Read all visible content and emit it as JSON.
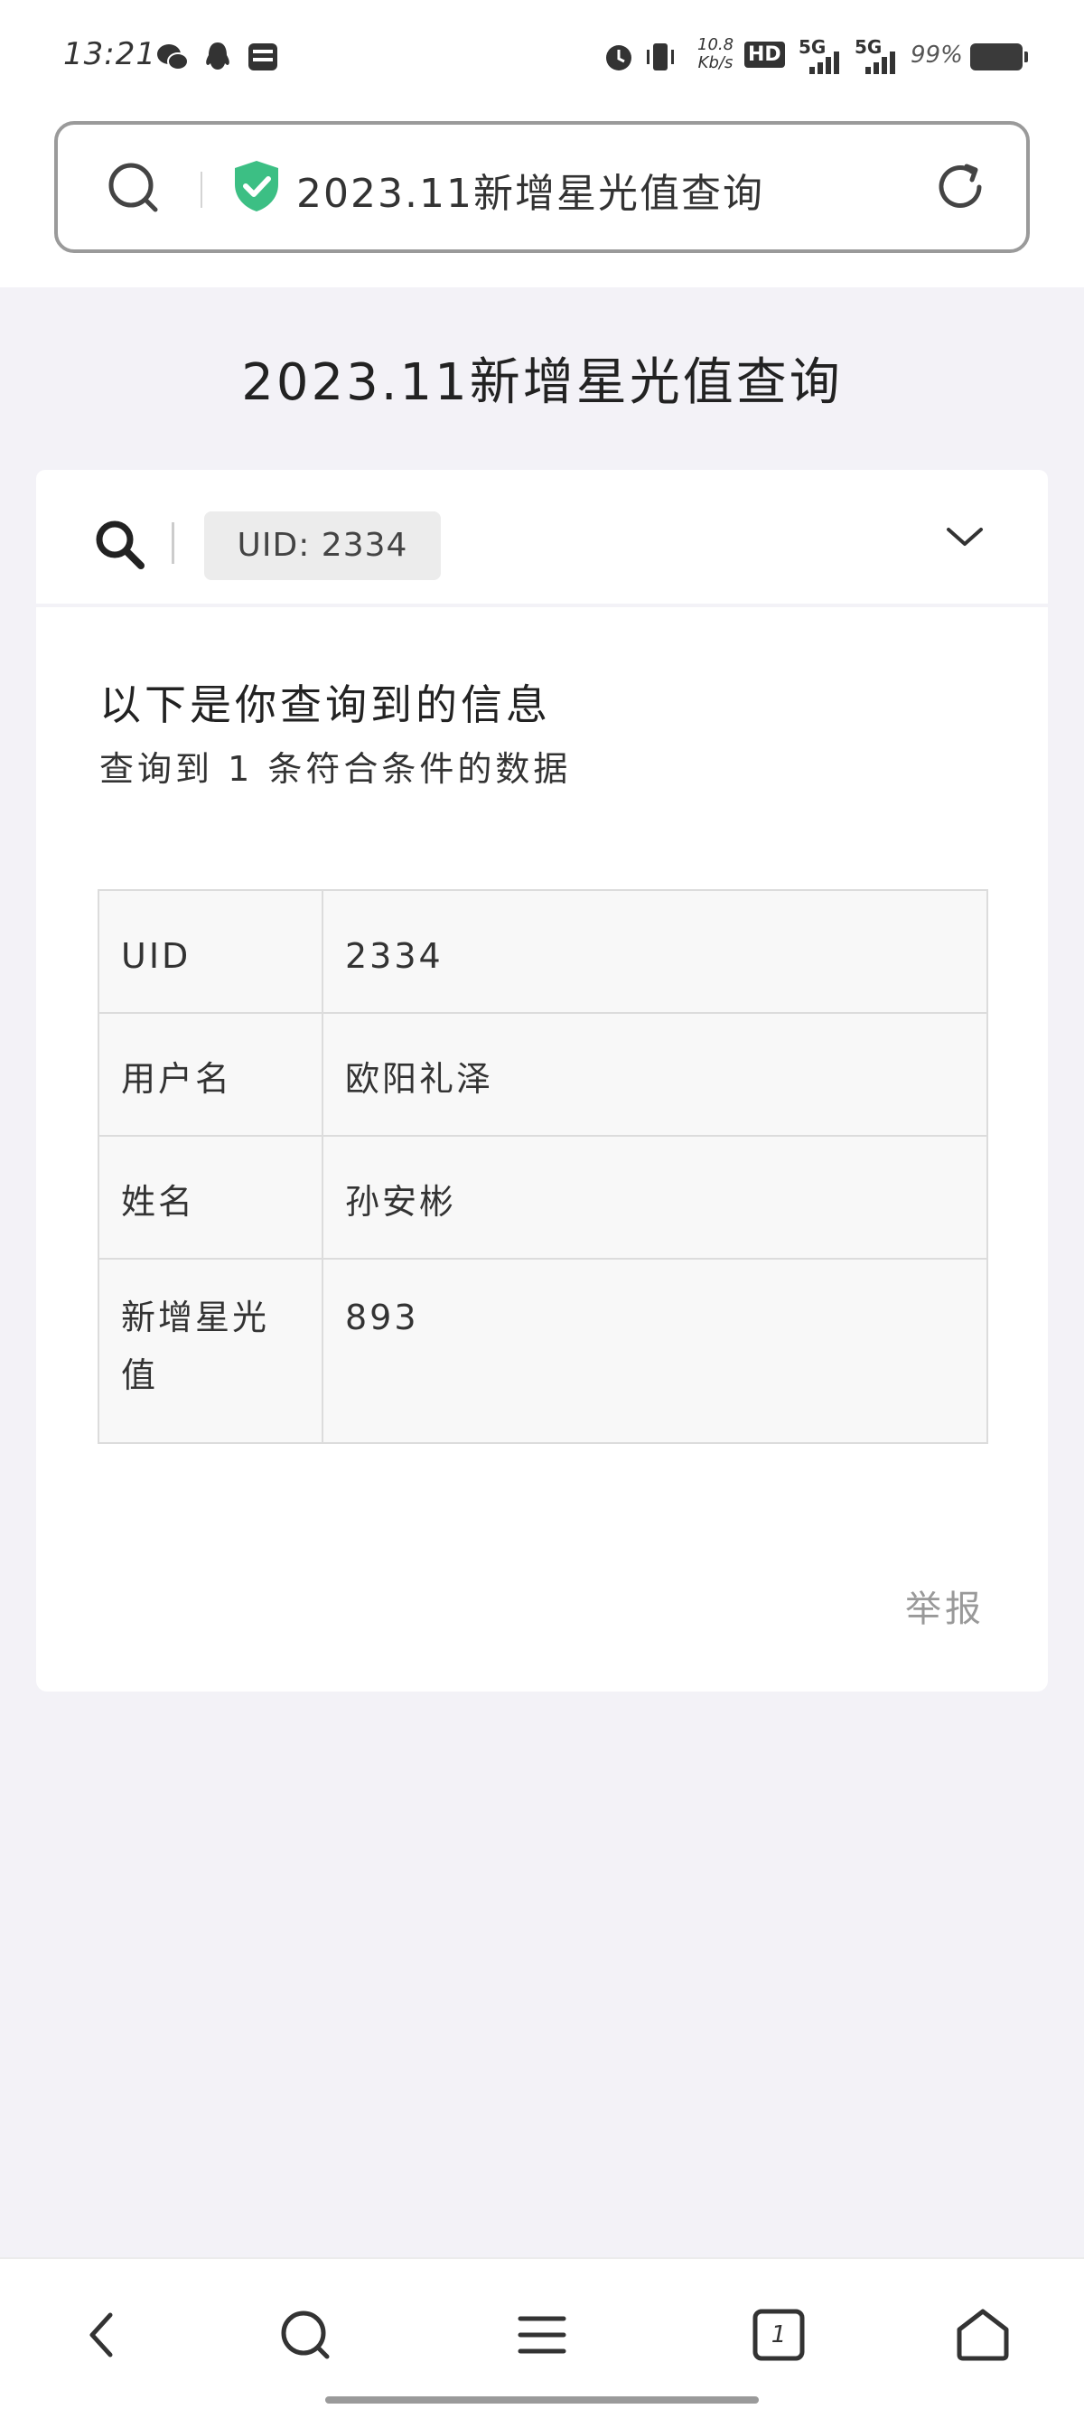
{
  "status_bar": {
    "time": "13:21",
    "net_speed": "10.8 Kb/s",
    "hd_label": "HD",
    "sim1": "5G",
    "sim2": "5G",
    "battery": "99%",
    "icons": [
      "wechat-icon",
      "qq-icon",
      "card-icon",
      "alarm-icon",
      "vibrate-icon",
      "signal-icon",
      "battery-icon"
    ]
  },
  "browser": {
    "address_title": "2023.11新增星光值查询",
    "icons": [
      "search-icon",
      "shield-check-icon",
      "reload-icon"
    ],
    "accent_color": "#3cbf84"
  },
  "page": {
    "title": "2023.11新增星光值查询"
  },
  "search": {
    "uid_tag": "UID: 2334",
    "icons": [
      "search-icon",
      "chevron-down-icon"
    ]
  },
  "result": {
    "heading": "以下是你查询到的信息",
    "count_text": "查询到 1 条符合条件的数据",
    "rows": [
      {
        "key": "UID",
        "value": "2334"
      },
      {
        "key": "用户名",
        "value": "欧阳礼泽"
      },
      {
        "key": "姓名",
        "value": "孙安彬"
      },
      {
        "key": "新增星光值",
        "value": "893"
      }
    ],
    "report_label": "举报"
  },
  "bottom_nav": {
    "items": [
      "back-icon",
      "search-icon",
      "menu-icon",
      "tabs-icon",
      "home-icon"
    ],
    "tabs_count": "1"
  }
}
